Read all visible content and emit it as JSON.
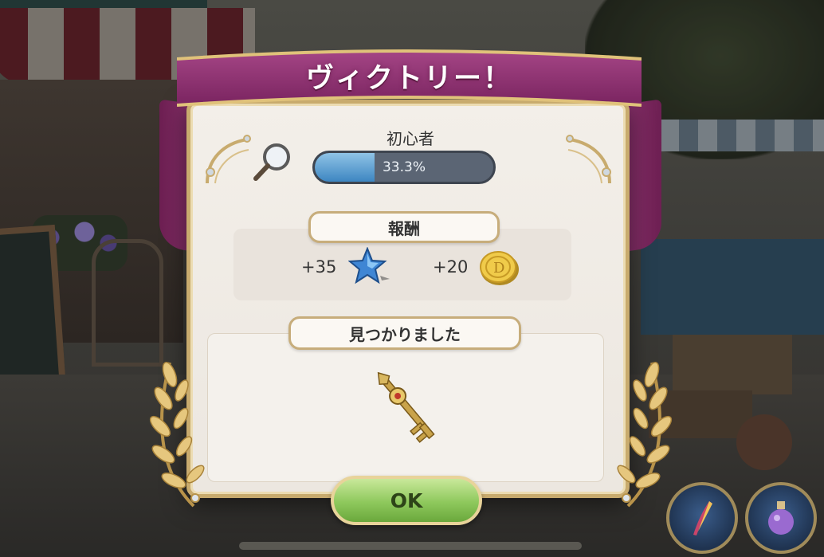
{
  "dialog": {
    "title": "ヴィクトリー！",
    "rank": {
      "label": "初心者",
      "progress_text": "33.3%",
      "progress_fraction": 0.333
    },
    "reward": {
      "heading": "報酬",
      "star_amount": "+35",
      "coin_amount": "+20"
    },
    "found": {
      "heading": "見つかりました",
      "item_icon": "ornate-key-icon"
    },
    "ok_label": "OK"
  },
  "icons": [
    "magnifier-icon",
    "star-icon",
    "coin-icon",
    "ornate-key-icon",
    "laurel-icon",
    "hint-feather-icon",
    "potion-icon"
  ],
  "colors": {
    "ribbon": "#8e3470",
    "progress_fill": "#3d86c2",
    "ok_button": "#8ec85c",
    "gold_trim": "#c8ab6e"
  }
}
